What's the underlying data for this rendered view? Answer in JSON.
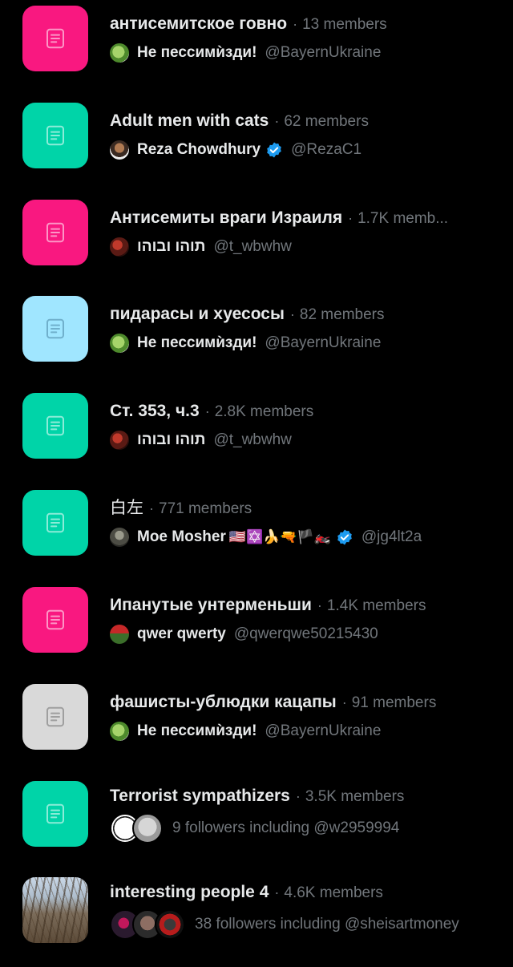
{
  "lists": [
    {
      "title": "антисемитское говно",
      "members": "13 members",
      "thumb_color": "#f91880",
      "icon": "list-icon",
      "owner": {
        "name": "Не пессимѝзди!",
        "handle": "@BayernUkraine",
        "verified": false,
        "avatar": "green-frog-avatar"
      }
    },
    {
      "title": "Adult men with cats",
      "members": "62 members",
      "thumb_color": "#00d4a8",
      "icon": "list-icon",
      "owner": {
        "name": "Reza Chowdhury",
        "handle": "@RezaC1",
        "verified": true,
        "avatar": "person-avatar"
      }
    },
    {
      "title": "Антисемиты враги Израиля",
      "members": "1.7K memb...",
      "thumb_color": "#f91880",
      "icon": "list-icon",
      "owner": {
        "name": "תוהו ובוהו",
        "handle": "@t_wbwhw",
        "verified": false,
        "avatar": "red-dark-avatar"
      }
    },
    {
      "title": "пидарасы и хуесосы",
      "members": "82 members",
      "thumb_color": "#a0e6ff",
      "icon": "list-icon",
      "owner": {
        "name": "Не пессимѝзди!",
        "handle": "@BayernUkraine",
        "verified": false,
        "avatar": "green-frog-avatar"
      }
    },
    {
      "title": "Ст. 353, ч.3",
      "members": "2.8K members",
      "thumb_color": "#00d4a8",
      "icon": "list-icon",
      "owner": {
        "name": "תוהו ובוהו",
        "handle": "@t_wbwhw",
        "verified": false,
        "avatar": "red-dark-avatar"
      }
    },
    {
      "title": "白左",
      "members": "771 members",
      "thumb_color": "#00d4a8",
      "icon": "list-icon",
      "owner": {
        "name": "Moe Mosher",
        "emojis": "🇺🇸✡️🍌🔫🏴🏍️",
        "handle": "@jg4lt2a",
        "verified": true,
        "avatar": "grey-person-avatar"
      }
    },
    {
      "title": "Ипанутые унтерменьши",
      "members": "1.4K members",
      "thumb_color": "#f91880",
      "icon": "list-icon",
      "owner": {
        "name": "qwer qwerty",
        "handle": "@qwerqwe50215430",
        "verified": false,
        "avatar": "red-tank-avatar"
      }
    },
    {
      "title": "фашисты-ублюдки кацапы",
      "members": "91 members",
      "thumb_color": "#d9d9d9",
      "icon": "list-icon",
      "owner": {
        "name": "Не пессимѝзди!",
        "handle": "@BayernUkraine",
        "verified": false,
        "avatar": "green-frog-avatar"
      }
    },
    {
      "title": "Terrorist sympathizers",
      "members": "3.5K members",
      "thumb_color": "#00d4a8",
      "icon": "list-icon",
      "followers": {
        "text": "9 followers including @w2959994",
        "avatars": [
          "nakba-75-avatar",
          "grey-avatar"
        ]
      }
    },
    {
      "title": "interesting people 4",
      "members": "4.6K members",
      "thumb_color": "photo",
      "icon": "forest-photo",
      "followers": {
        "text": "38 followers including @sheisartmoney",
        "avatars": [
          "dark-avatar-1",
          "dark-avatar-2",
          "dark-avatar-3"
        ]
      }
    }
  ],
  "separator": "·"
}
